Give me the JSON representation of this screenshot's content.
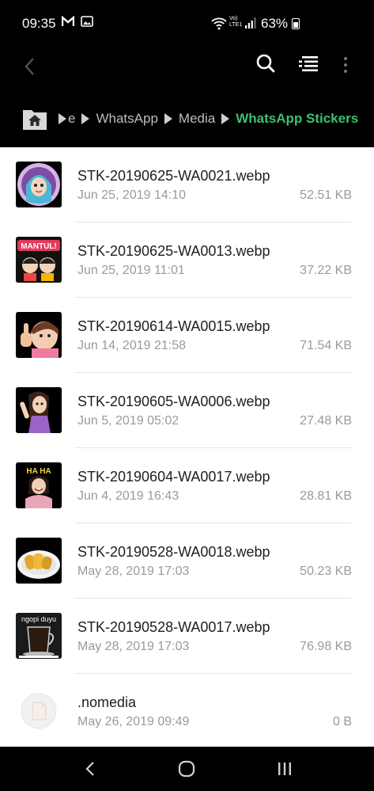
{
  "status_bar": {
    "time": "09:35",
    "battery": "63%",
    "network_label": "Vo) LTE1"
  },
  "app_bar": {
    "back_icon": "chevron-left-icon",
    "search_icon": "search-icon",
    "list_view_icon": "list-view-icon",
    "more_icon": "more-vertical-icon"
  },
  "breadcrumb": {
    "partial": "e",
    "items": [
      "WhatsApp",
      "Media"
    ],
    "current": "WhatsApp Stickers",
    "active_color": "#3fbf71"
  },
  "files": [
    {
      "name": "STK-20190625-WA0021.webp",
      "date": "Jun 25, 2019 14:10",
      "size": "52.51 KB",
      "thumb": "sticker-hijab-girl"
    },
    {
      "name": "STK-20190625-WA0013.webp",
      "date": "Jun 25, 2019 11:01",
      "size": "37.22 KB",
      "thumb": "sticker-mantul",
      "thumb_text": "MANTUL!"
    },
    {
      "name": "STK-20190614-WA0015.webp",
      "date": "Jun 14, 2019 21:58",
      "size": "71.54 KB",
      "thumb": "sticker-thumbs-up-girl"
    },
    {
      "name": "STK-20190605-WA0006.webp",
      "date": "Jun 5, 2019 05:02",
      "size": "27.48 KB",
      "thumb": "sticker-girl-pose"
    },
    {
      "name": "STK-20190604-WA0017.webp",
      "date": "Jun 4, 2019 16:43",
      "size": "28.81 KB",
      "thumb": "sticker-haha-girl",
      "thumb_text": "HA HA"
    },
    {
      "name": "STK-20190528-WA0018.webp",
      "date": "May 28, 2019 17:03",
      "size": "50.23 KB",
      "thumb": "sticker-fried-food"
    },
    {
      "name": "STK-20190528-WA0017.webp",
      "date": "May 28, 2019 17:03",
      "size": "76.98 KB",
      "thumb": "sticker-coffee",
      "thumb_text": "ngopi duyu"
    },
    {
      "name": ".nomedia",
      "date": "May 26, 2019 09:49",
      "size": "0 B",
      "thumb": "file-icon"
    }
  ],
  "nav_bar": {
    "back_icon": "nav-back-icon",
    "home_icon": "nav-home-icon",
    "recents_icon": "nav-recents-icon"
  }
}
